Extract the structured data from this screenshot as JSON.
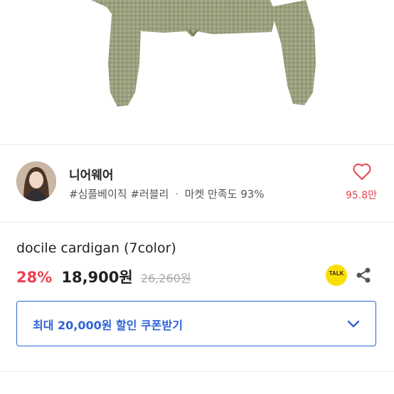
{
  "shop": {
    "name": "니어웨어",
    "tag1": "#심플베이직",
    "tag2": "#러블리",
    "separator": "·",
    "satisfaction": "마켓 만족도 93%",
    "likes": "95.8만"
  },
  "product": {
    "title": "docile cardigan (7color)",
    "discount": "28%",
    "price": "18,900원",
    "original_price": "26,260원"
  },
  "actions": {
    "talk_label": "TALK"
  },
  "coupon": {
    "label": "최대 20,000원 할인 쿠폰받기"
  },
  "colors": {
    "accent_blue": "#2f63d6",
    "discount_red": "#ef3f4f",
    "heart_red": "#e6454f",
    "kakao_yellow": "#f9e000"
  }
}
